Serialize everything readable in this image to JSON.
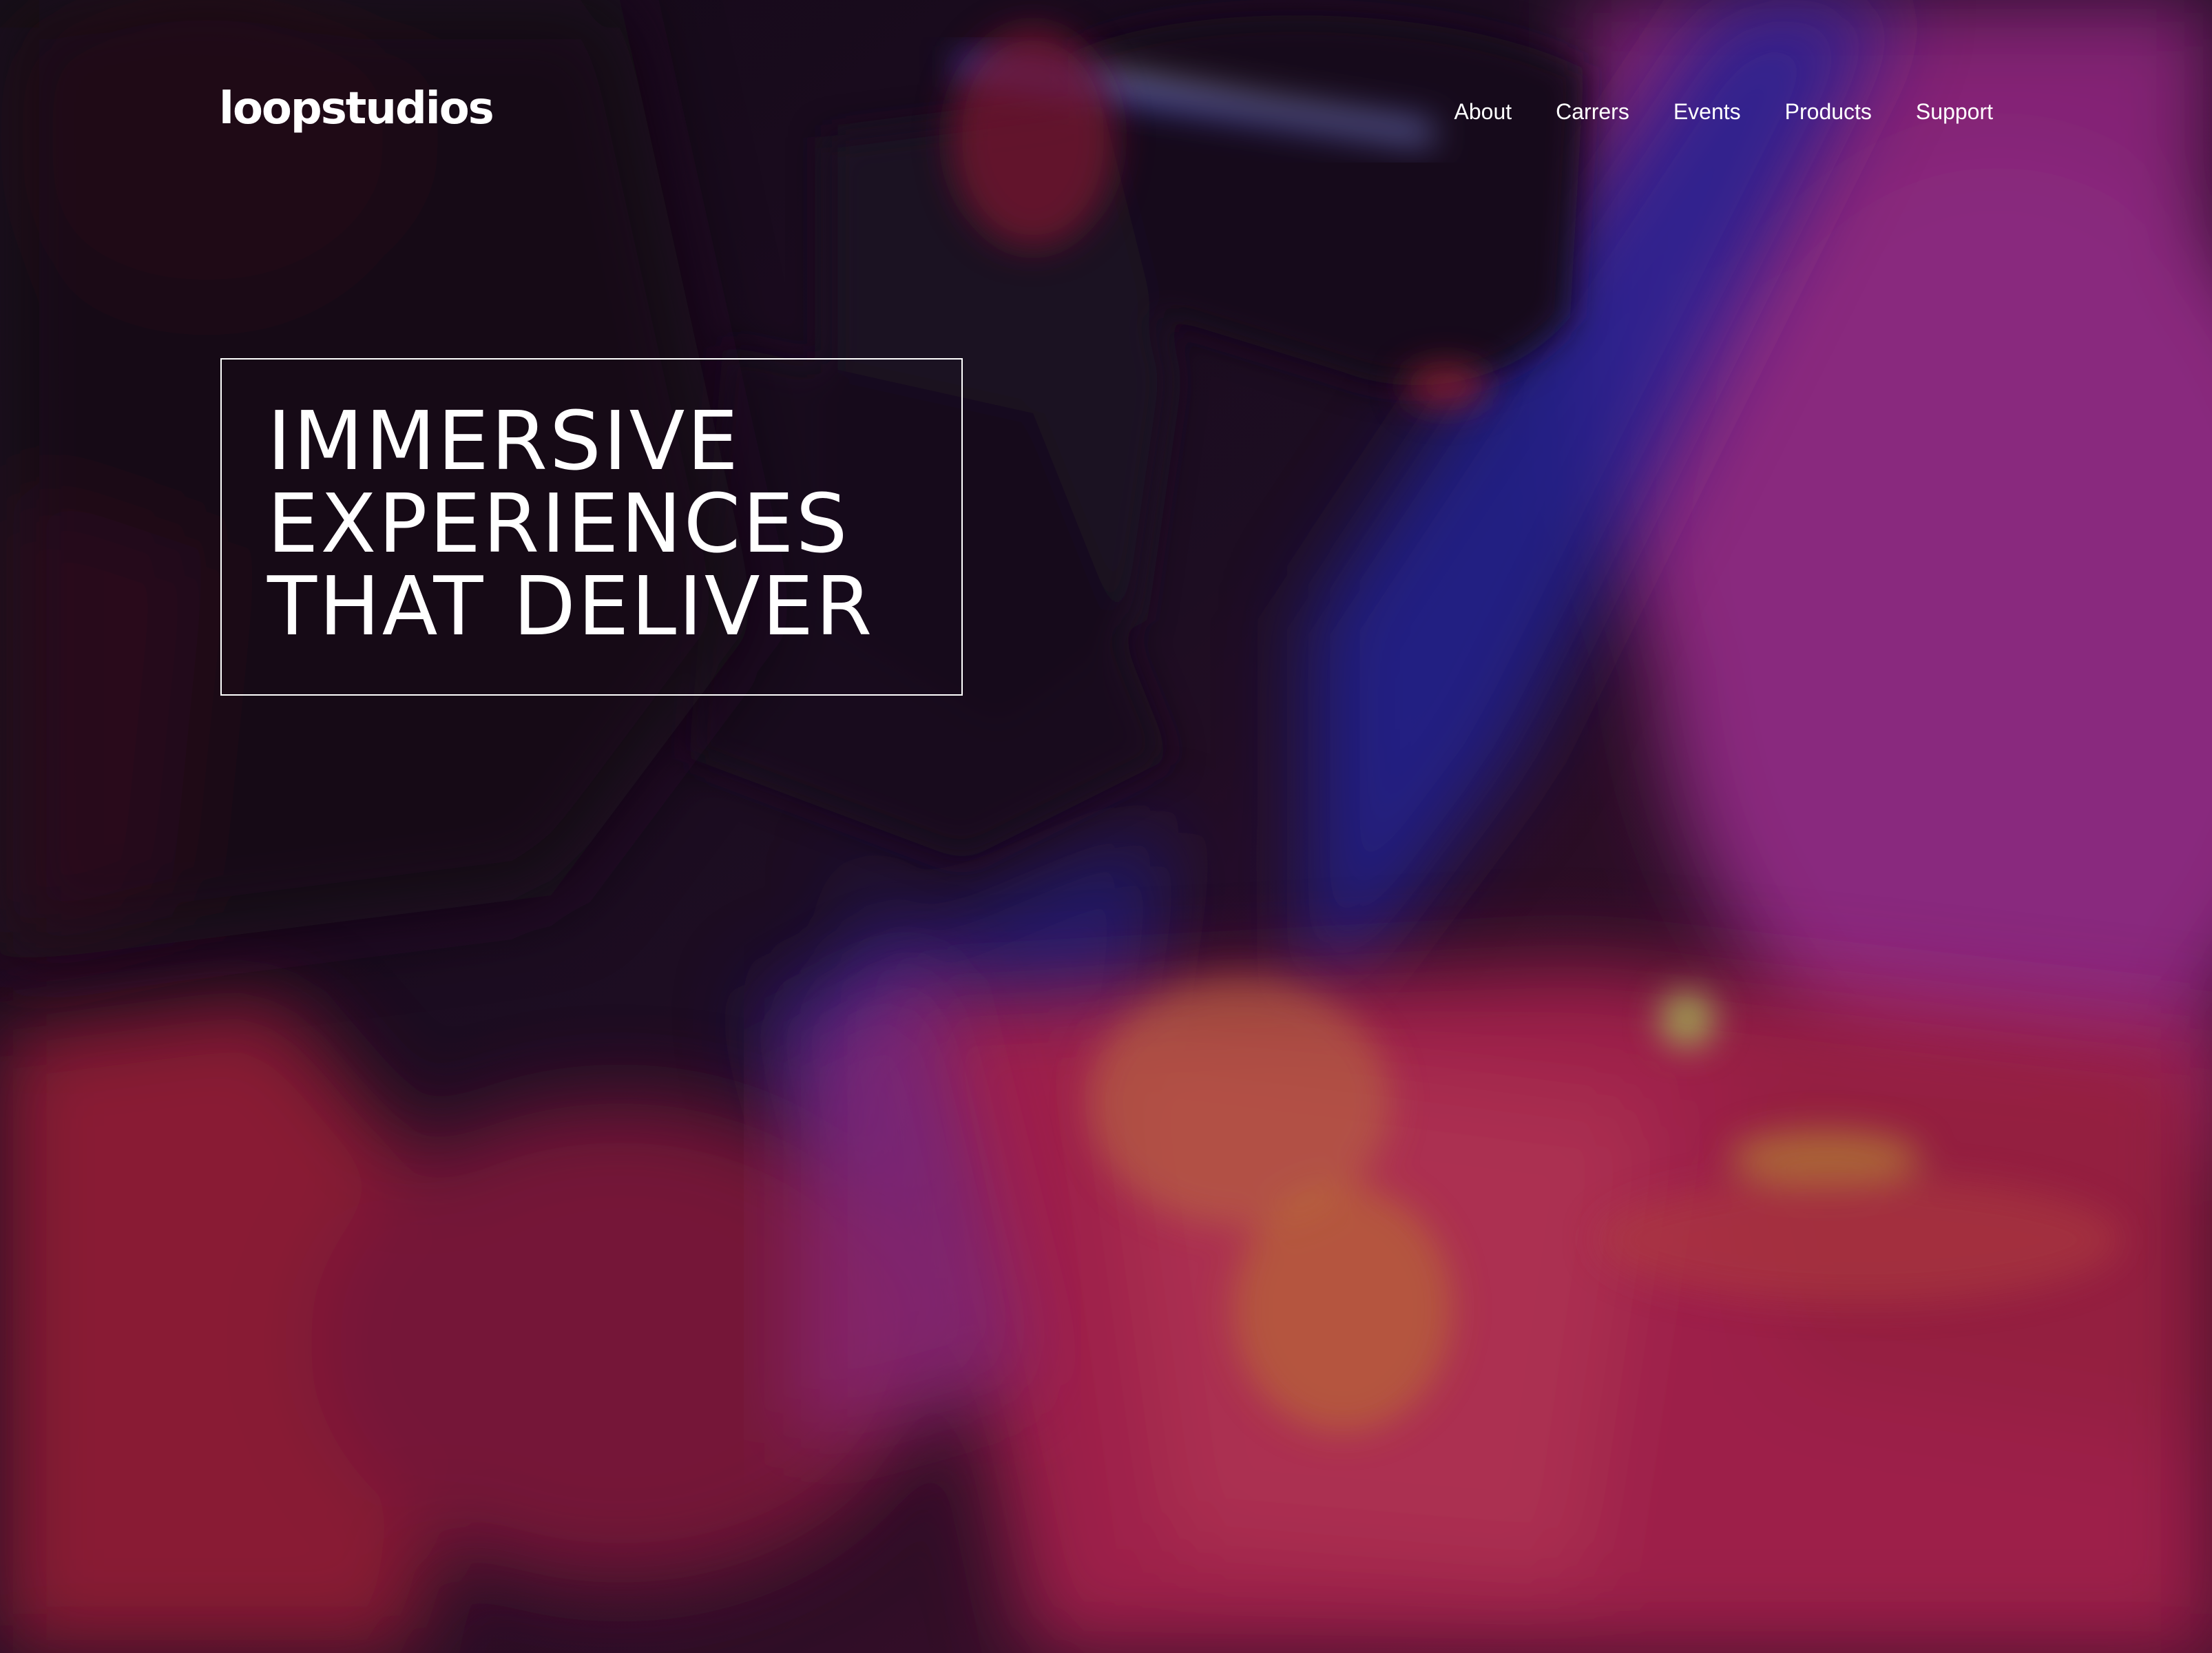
{
  "header": {
    "logo": "loopstudios",
    "nav": [
      {
        "label": "About"
      },
      {
        "label": "Carrers"
      },
      {
        "label": "Events"
      },
      {
        "label": "Products"
      },
      {
        "label": "Support"
      }
    ]
  },
  "hero": {
    "headline_lines": [
      "IMMERSIVE",
      "EXPERIENCES",
      "THAT DELIVER"
    ],
    "image_description_icon": "vr-headset-photo"
  },
  "colors": {
    "background_dark": "#140b1f",
    "magenta": "#a42a8f",
    "red": "#c4244a",
    "blue": "#2b2fb8",
    "text": "#ffffff"
  }
}
